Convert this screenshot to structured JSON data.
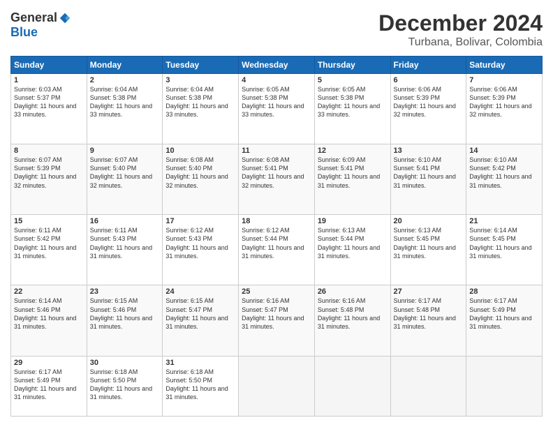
{
  "logo": {
    "general": "General",
    "blue": "Blue"
  },
  "title": "December 2024",
  "location": "Turbana, Bolivar, Colombia",
  "days": [
    "Sunday",
    "Monday",
    "Tuesday",
    "Wednesday",
    "Thursday",
    "Friday",
    "Saturday"
  ],
  "weeks": [
    [
      {
        "day": 1,
        "sunrise": "6:03 AM",
        "sunset": "5:37 PM",
        "daylight": "11 hours and 33 minutes."
      },
      {
        "day": 2,
        "sunrise": "6:04 AM",
        "sunset": "5:38 PM",
        "daylight": "11 hours and 33 minutes."
      },
      {
        "day": 3,
        "sunrise": "6:04 AM",
        "sunset": "5:38 PM",
        "daylight": "11 hours and 33 minutes."
      },
      {
        "day": 4,
        "sunrise": "6:05 AM",
        "sunset": "5:38 PM",
        "daylight": "11 hours and 33 minutes."
      },
      {
        "day": 5,
        "sunrise": "6:05 AM",
        "sunset": "5:38 PM",
        "daylight": "11 hours and 33 minutes."
      },
      {
        "day": 6,
        "sunrise": "6:06 AM",
        "sunset": "5:39 PM",
        "daylight": "11 hours and 32 minutes."
      },
      {
        "day": 7,
        "sunrise": "6:06 AM",
        "sunset": "5:39 PM",
        "daylight": "11 hours and 32 minutes."
      }
    ],
    [
      {
        "day": 8,
        "sunrise": "6:07 AM",
        "sunset": "5:39 PM",
        "daylight": "11 hours and 32 minutes."
      },
      {
        "day": 9,
        "sunrise": "6:07 AM",
        "sunset": "5:40 PM",
        "daylight": "11 hours and 32 minutes."
      },
      {
        "day": 10,
        "sunrise": "6:08 AM",
        "sunset": "5:40 PM",
        "daylight": "11 hours and 32 minutes."
      },
      {
        "day": 11,
        "sunrise": "6:08 AM",
        "sunset": "5:41 PM",
        "daylight": "11 hours and 32 minutes."
      },
      {
        "day": 12,
        "sunrise": "6:09 AM",
        "sunset": "5:41 PM",
        "daylight": "11 hours and 31 minutes."
      },
      {
        "day": 13,
        "sunrise": "6:10 AM",
        "sunset": "5:41 PM",
        "daylight": "11 hours and 31 minutes."
      },
      {
        "day": 14,
        "sunrise": "6:10 AM",
        "sunset": "5:42 PM",
        "daylight": "11 hours and 31 minutes."
      }
    ],
    [
      {
        "day": 15,
        "sunrise": "6:11 AM",
        "sunset": "5:42 PM",
        "daylight": "11 hours and 31 minutes."
      },
      {
        "day": 16,
        "sunrise": "6:11 AM",
        "sunset": "5:43 PM",
        "daylight": "11 hours and 31 minutes."
      },
      {
        "day": 17,
        "sunrise": "6:12 AM",
        "sunset": "5:43 PM",
        "daylight": "11 hours and 31 minutes."
      },
      {
        "day": 18,
        "sunrise": "6:12 AM",
        "sunset": "5:44 PM",
        "daylight": "11 hours and 31 minutes."
      },
      {
        "day": 19,
        "sunrise": "6:13 AM",
        "sunset": "5:44 PM",
        "daylight": "11 hours and 31 minutes."
      },
      {
        "day": 20,
        "sunrise": "6:13 AM",
        "sunset": "5:45 PM",
        "daylight": "11 hours and 31 minutes."
      },
      {
        "day": 21,
        "sunrise": "6:14 AM",
        "sunset": "5:45 PM",
        "daylight": "11 hours and 31 minutes."
      }
    ],
    [
      {
        "day": 22,
        "sunrise": "6:14 AM",
        "sunset": "5:46 PM",
        "daylight": "11 hours and 31 minutes."
      },
      {
        "day": 23,
        "sunrise": "6:15 AM",
        "sunset": "5:46 PM",
        "daylight": "11 hours and 31 minutes."
      },
      {
        "day": 24,
        "sunrise": "6:15 AM",
        "sunset": "5:47 PM",
        "daylight": "11 hours and 31 minutes."
      },
      {
        "day": 25,
        "sunrise": "6:16 AM",
        "sunset": "5:47 PM",
        "daylight": "11 hours and 31 minutes."
      },
      {
        "day": 26,
        "sunrise": "6:16 AM",
        "sunset": "5:48 PM",
        "daylight": "11 hours and 31 minutes."
      },
      {
        "day": 27,
        "sunrise": "6:17 AM",
        "sunset": "5:48 PM",
        "daylight": "11 hours and 31 minutes."
      },
      {
        "day": 28,
        "sunrise": "6:17 AM",
        "sunset": "5:49 PM",
        "daylight": "11 hours and 31 minutes."
      }
    ],
    [
      {
        "day": 29,
        "sunrise": "6:17 AM",
        "sunset": "5:49 PM",
        "daylight": "11 hours and 31 minutes."
      },
      {
        "day": 30,
        "sunrise": "6:18 AM",
        "sunset": "5:50 PM",
        "daylight": "11 hours and 31 minutes."
      },
      {
        "day": 31,
        "sunrise": "6:18 AM",
        "sunset": "5:50 PM",
        "daylight": "11 hours and 31 minutes."
      },
      null,
      null,
      null,
      null
    ]
  ]
}
